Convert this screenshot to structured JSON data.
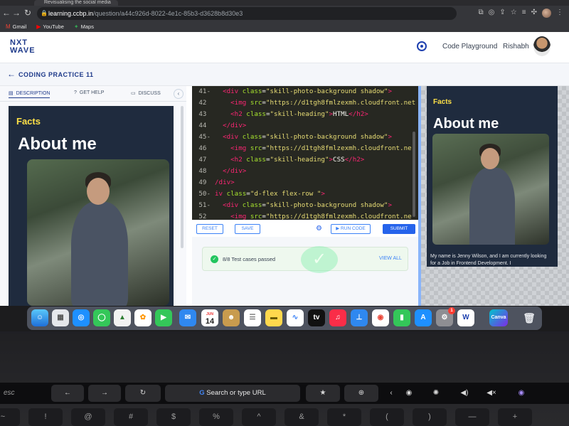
{
  "browser": {
    "tab_title": "Revisualising the social media",
    "url_host": "learning.ccbp.in",
    "url_path": "/question/a44c926d-8022-4e1c-85b3-d3628b8d30e3",
    "bookmarks": [
      {
        "label": "Gmail",
        "icon": "M"
      },
      {
        "label": "YouTube",
        "icon": "▶"
      },
      {
        "label": "Maps",
        "icon": "✦"
      }
    ]
  },
  "header": {
    "logo_line1": "NXT",
    "logo_line2": "WAVE",
    "code_playground": "Code Playground",
    "username": "Rishabh"
  },
  "subbar": {
    "title": "CODING PRACTICE 11"
  },
  "left_tabs": {
    "description": "DESCRIPTION",
    "get_help": "GET HELP",
    "discuss": "DISCUSS"
  },
  "preview": {
    "facts": "Facts",
    "about": "About me",
    "description": "My name is Jenny Wilson, and I am currently looking for a Job in Frontend Development. I"
  },
  "editor": {
    "lines": [
      {
        "n": "41",
        "fold": "-",
        "indent": "  ",
        "parts": [
          [
            "tag",
            "<div "
          ],
          [
            "attr",
            "class"
          ],
          [
            "plain",
            "="
          ],
          [
            "str",
            "\"skill-photo-background shadow\""
          ],
          [
            "tag",
            ">"
          ]
        ]
      },
      {
        "n": "42",
        "fold": "",
        "indent": "    ",
        "parts": [
          [
            "tag",
            "<img "
          ],
          [
            "attr",
            "src"
          ],
          [
            "plain",
            "="
          ],
          [
            "str",
            "\"https://d1tgh8fmlzexmh.cloudfront.net"
          ]
        ]
      },
      {
        "n": "43",
        "fold": "",
        "indent": "    ",
        "parts": [
          [
            "tag",
            "<h2 "
          ],
          [
            "attr",
            "class"
          ],
          [
            "plain",
            "="
          ],
          [
            "str",
            "\"skill-heading\""
          ],
          [
            "tag",
            ">"
          ],
          [
            "plain",
            "HTML"
          ],
          [
            "tag",
            "</h2>"
          ]
        ]
      },
      {
        "n": "44",
        "fold": "",
        "indent": "  ",
        "parts": [
          [
            "tag",
            "</div>"
          ]
        ]
      },
      {
        "n": "45",
        "fold": "-",
        "indent": "  ",
        "parts": [
          [
            "tag",
            "<div "
          ],
          [
            "attr",
            "class"
          ],
          [
            "plain",
            "="
          ],
          [
            "str",
            "\"skill-photo-background shadow\""
          ],
          [
            "tag",
            ">"
          ]
        ]
      },
      {
        "n": "46",
        "fold": "",
        "indent": "    ",
        "parts": [
          [
            "tag",
            "<img "
          ],
          [
            "attr",
            "src"
          ],
          [
            "plain",
            "="
          ],
          [
            "str",
            "\"https://d1tgh8fmlzexmh.cloudfront.ne"
          ]
        ]
      },
      {
        "n": "47",
        "fold": "",
        "indent": "    ",
        "parts": [
          [
            "tag",
            "<h2 "
          ],
          [
            "attr",
            "class"
          ],
          [
            "plain",
            "="
          ],
          [
            "str",
            "\"skill-heading\""
          ],
          [
            "tag",
            ">"
          ],
          [
            "plain",
            "CSS"
          ],
          [
            "tag",
            "</h2>"
          ]
        ]
      },
      {
        "n": "48",
        "fold": "",
        "indent": "  ",
        "parts": [
          [
            "tag",
            "</div>"
          ]
        ]
      },
      {
        "n": "49",
        "fold": "",
        "indent": "",
        "parts": [
          [
            "tag",
            "/div>"
          ]
        ]
      },
      {
        "n": "50",
        "fold": "-",
        "indent": "",
        "parts": [
          [
            "tag",
            "iv "
          ],
          [
            "attr",
            "class"
          ],
          [
            "plain",
            "="
          ],
          [
            "str",
            "\"d-flex flex-row \""
          ],
          [
            "tag",
            ">"
          ]
        ]
      },
      {
        "n": "51",
        "fold": "-",
        "indent": "  ",
        "parts": [
          [
            "tag",
            "<div "
          ],
          [
            "attr",
            "class"
          ],
          [
            "plain",
            "="
          ],
          [
            "str",
            "\"skill-photo-background shadow\""
          ],
          [
            "tag",
            ">"
          ]
        ]
      },
      {
        "n": "52",
        "fold": "",
        "indent": "    ",
        "parts": [
          [
            "tag",
            "<img "
          ],
          [
            "attr",
            "src"
          ],
          [
            "plain",
            "="
          ],
          [
            "str",
            "\"https://d1tgh8fmlzexmh.cloudfront.ne"
          ]
        ]
      }
    ]
  },
  "actions": {
    "reset": "RESET",
    "save": "SAVE",
    "run_code": "▶ RUN CODE",
    "submit": "SUBMIT"
  },
  "results": {
    "passed": "8/8 Test cases passed",
    "view_all": "VIEW ALL"
  },
  "dock": {
    "calendar_month": "JUN",
    "calendar_day": "14",
    "tv_label": "tv",
    "canva_label": "Canva",
    "word_label": "W",
    "badge_count": "1"
  },
  "touchbar": {
    "esc": "esc",
    "search": "Search or type URL"
  },
  "keyboard": {
    "keys": [
      "~",
      "!",
      "@",
      "#",
      "$",
      "%",
      "^",
      "&",
      "*",
      "(",
      ")",
      "—",
      "+"
    ]
  }
}
